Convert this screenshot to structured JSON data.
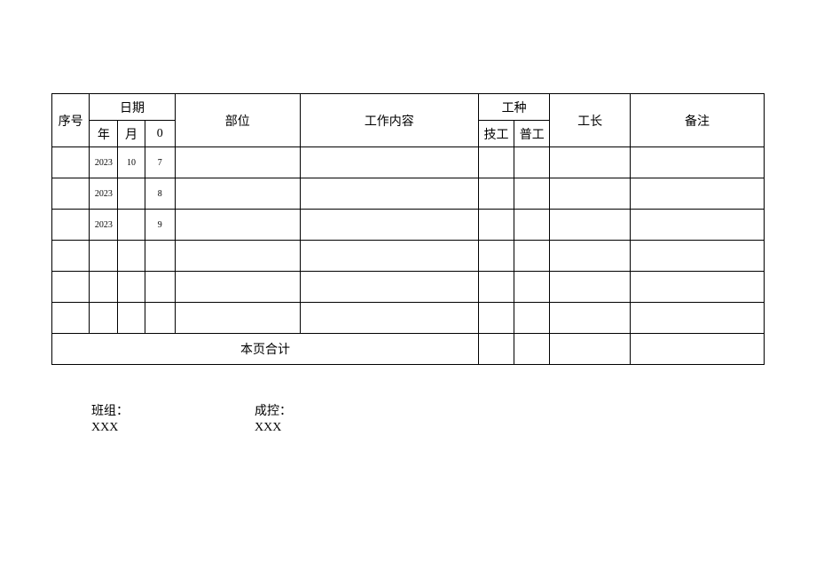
{
  "headers": {
    "seq": "序号",
    "date": "日期",
    "year": "年",
    "month": "月",
    "day": "0",
    "part": "部位",
    "work": "工作内容",
    "trade": "工种",
    "skilled": "技工",
    "unskilled": "普工",
    "foreman": "工长",
    "remark": "备注"
  },
  "rows": [
    {
      "seq": "",
      "year": "2023",
      "month": "10",
      "day": "7",
      "part": "",
      "work": "",
      "skilled": "",
      "unskilled": "",
      "foreman": "",
      "remark": ""
    },
    {
      "seq": "",
      "year": "2023",
      "month": "",
      "day": "8",
      "part": "",
      "work": "",
      "skilled": "",
      "unskilled": "",
      "foreman": "",
      "remark": ""
    },
    {
      "seq": "",
      "year": "2023",
      "month": "",
      "day": "9",
      "part": "",
      "work": "",
      "skilled": "",
      "unskilled": "",
      "foreman": "",
      "remark": ""
    },
    {
      "seq": "",
      "year": "",
      "month": "",
      "day": "",
      "part": "",
      "work": "",
      "skilled": "",
      "unskilled": "",
      "foreman": "",
      "remark": ""
    },
    {
      "seq": "",
      "year": "",
      "month": "",
      "day": "",
      "part": "",
      "work": "",
      "skilled": "",
      "unskilled": "",
      "foreman": "",
      "remark": ""
    },
    {
      "seq": "",
      "year": "",
      "month": "",
      "day": "",
      "part": "",
      "work": "",
      "skilled": "",
      "unskilled": "",
      "foreman": "",
      "remark": ""
    }
  ],
  "total_label": "本页合计",
  "totals": {
    "skilled": "",
    "unskilled": "",
    "foreman": "",
    "remark": ""
  },
  "signatures": {
    "team_label": "班组：",
    "team_value": "XXX",
    "cost_label": "成控：",
    "cost_value": "XXX"
  }
}
